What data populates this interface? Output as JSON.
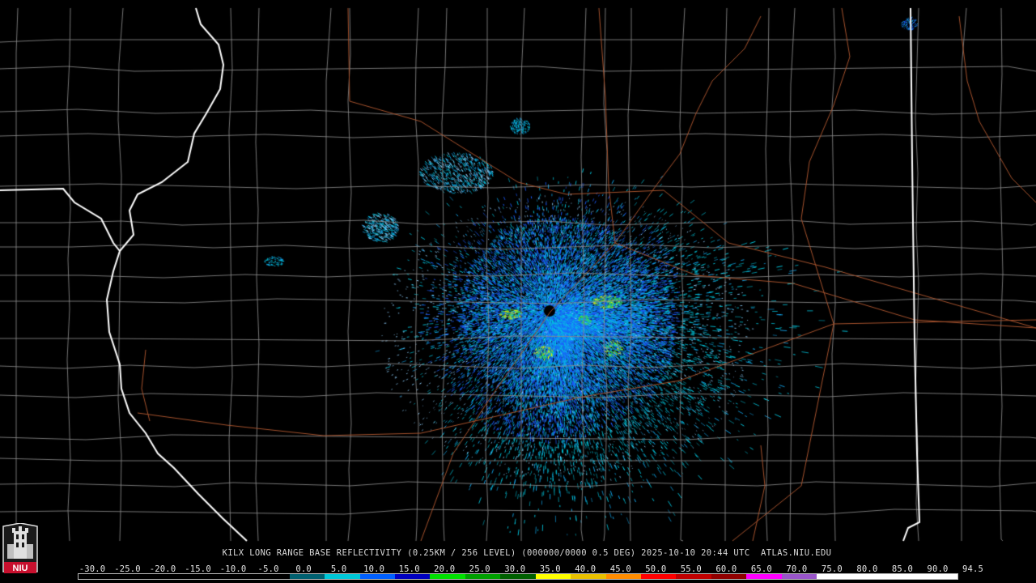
{
  "caption": "KILX LONG RANGE BASE REFLECTIVITY (0.25KM / 256 LEVEL) (000000/0000 0.5 DEG) 2025-10-10 20:44 UTC  ATLAS.NIU.EDU",
  "logo": {
    "text": "NIU",
    "icon": "niu-tower-logo-icon",
    "bg_color": "#c8102e"
  },
  "colorbar": {
    "labels": [
      "-30.0",
      "-25.0",
      "-20.0",
      "-15.0",
      "-10.0",
      "-5.0",
      "0.0",
      "5.0",
      "10.0",
      "15.0",
      "20.0",
      "25.0",
      "30.0",
      "35.0",
      "40.0",
      "45.0",
      "50.0",
      "55.0",
      "60.0",
      "65.0",
      "70.0",
      "75.0",
      "80.0",
      "85.0",
      "90.0",
      "94.5"
    ],
    "colors": [
      "#000000",
      "#000000",
      "#000000",
      "#000000",
      "#000000",
      "#000000",
      "#006070",
      "#00c8d8",
      "#0060ff",
      "#0000c0",
      "#00e000",
      "#00a000",
      "#006000",
      "#ffff00",
      "#e8c000",
      "#ff8c00",
      "#ff0000",
      "#c00000",
      "#900000",
      "#ff00ff",
      "#9955c9",
      "#ffffff",
      "#ffffff",
      "#ffffff",
      "#ffffff"
    ]
  },
  "map": {
    "radar_site": "KILX",
    "state_line_color": "#ffffff",
    "county_line_color": "#8a8a8a",
    "highway_color": "#a5522d",
    "echo_colors": [
      "#00c8e0",
      "#11a8f0",
      "#1b5cff",
      "#8fd0ff",
      "#3ee23e",
      "#f0f000"
    ]
  }
}
